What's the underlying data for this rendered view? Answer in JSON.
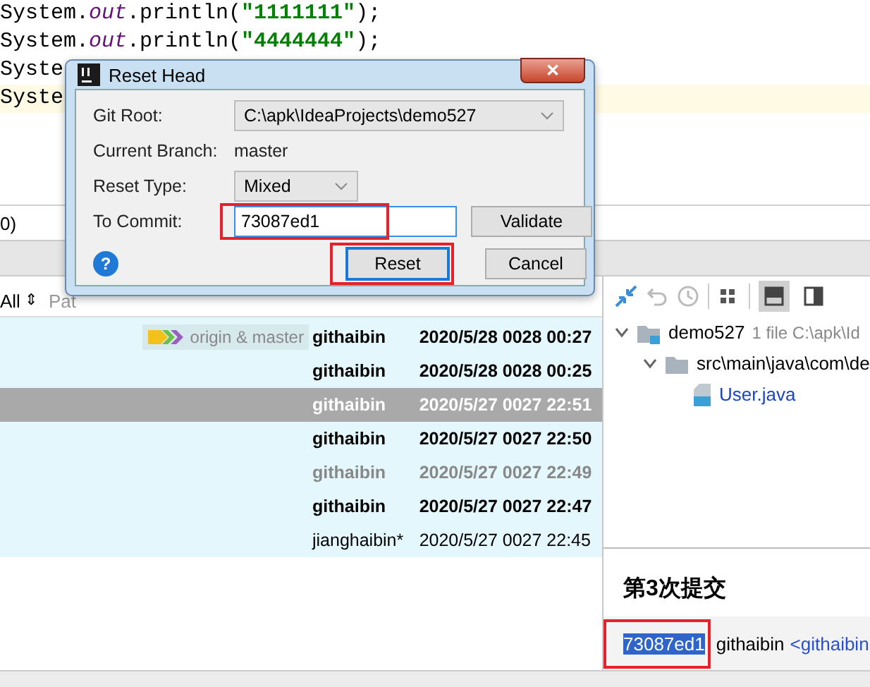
{
  "editor": {
    "lines": [
      {
        "obj": "System.",
        "field": "out",
        "call": ".println(",
        "arg": "\"1111111\"",
        "end": ");",
        "current": false
      },
      {
        "obj": "System.",
        "field": "out",
        "call": ".println(",
        "arg": "\"4444444\"",
        "end": ");",
        "current": false
      },
      {
        "obj": "Syste",
        "current": false
      },
      {
        "obj": "Syste",
        "current": true
      }
    ]
  },
  "tool_strip": {
    "text": "0)"
  },
  "filter_bar": {
    "branch": "All",
    "branch_arrow": "⇕",
    "path": "Pat"
  },
  "log": {
    "rows": [
      {
        "tag": "origin & master",
        "author": "githaibin",
        "date": "2020/5/28 0028 00:27",
        "kind": "bold",
        "selected": false
      },
      {
        "author": "githaibin",
        "date": "2020/5/28 0028 00:25",
        "kind": "bold",
        "selected": false
      },
      {
        "author": "githaibin",
        "date": "2020/5/27 0027 22:51",
        "kind": "bold",
        "selected": true
      },
      {
        "author": "githaibin",
        "date": "2020/5/27 0027 22:50",
        "kind": "bold",
        "selected": false
      },
      {
        "author": "githaibin",
        "date": "2020/5/27 0027 22:49",
        "kind": "muted",
        "selected": false
      },
      {
        "author": "githaibin",
        "date": "2020/5/27 0027 22:47",
        "kind": "bold",
        "selected": false
      },
      {
        "author": "jianghaibin*",
        "date": "2020/5/27 0027 22:45",
        "kind": "normal",
        "selected": false
      }
    ]
  },
  "changes": {
    "tree": [
      {
        "label": "demo527",
        "info": "1 file  C:\\apk\\Id",
        "kind": "module",
        "expanded": true,
        "children": [
          {
            "label": "src\\main\\java\\com\\de",
            "kind": "folder",
            "expanded": true,
            "children": [
              {
                "label": "User.java",
                "kind": "file"
              }
            ]
          }
        ]
      }
    ]
  },
  "details": {
    "message": "第3次提交",
    "hash": "73087ed1",
    "hash_annotated": true,
    "author": "githaibin",
    "email": "<githaibin"
  },
  "dialog": {
    "title": "Reset Head",
    "close": "✕",
    "git_root": {
      "label": "Git Root:",
      "value": "C:\\apk\\IdeaProjects\\demo527"
    },
    "branch": {
      "label": "Current Branch:",
      "value": "master"
    },
    "reset_type": {
      "label": "Reset Type:",
      "value": "Mixed"
    },
    "to_commit": {
      "label": "To Commit:",
      "value": "73087ed1",
      "annotated": true
    },
    "validate": "Validate",
    "help": "?",
    "buttons": [
      {
        "label": "Reset",
        "default": true,
        "annotated": true
      },
      {
        "label": "Cancel",
        "default": false,
        "annotated": false
      }
    ]
  }
}
